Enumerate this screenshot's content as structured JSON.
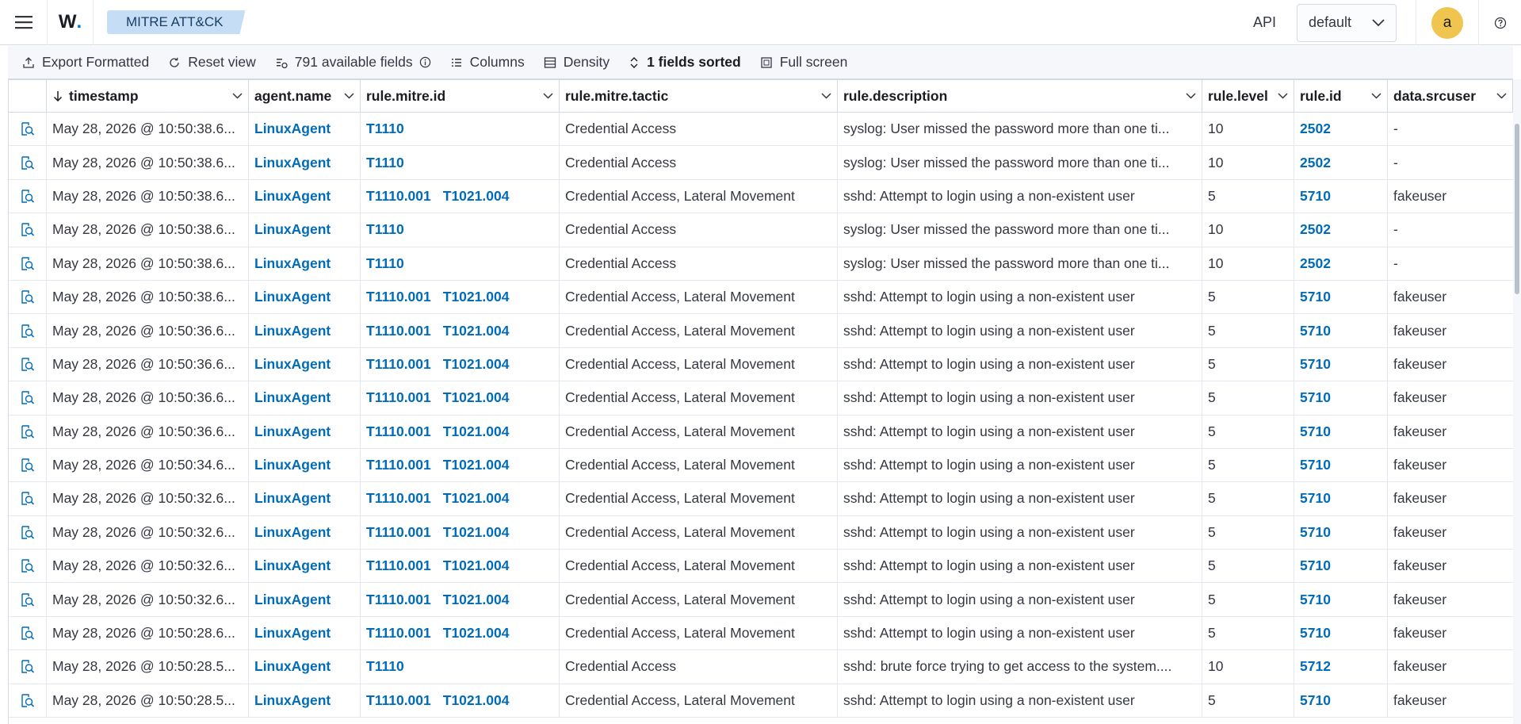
{
  "header": {
    "logo": "W",
    "logo_dot": ".",
    "breadcrumb": "MITRE ATT&CK",
    "api_label": "API",
    "tenant": "default",
    "avatar_initial": "a"
  },
  "toolbar": {
    "export": "Export Formatted",
    "reset": "Reset view",
    "fields": "791 available fields",
    "columns": "Columns",
    "density": "Density",
    "sorted": "1 fields sorted",
    "fullscreen": "Full screen"
  },
  "table": {
    "columns": [
      "timestamp",
      "agent.name",
      "rule.mitre.id",
      "rule.mitre.tactic",
      "rule.description",
      "rule.level",
      "rule.id",
      "data.srcuser"
    ],
    "rows": [
      {
        "timestamp": "May 28, 2026 @ 10:50:38.6...",
        "agent": "LinuxAgent",
        "mitre_ids": [
          "T1110"
        ],
        "tactic": "Credential Access",
        "description": "syslog: User missed the password more than one ti...",
        "level": "10",
        "rule_id": "2502",
        "srcuser": "-"
      },
      {
        "timestamp": "May 28, 2026 @ 10:50:38.6...",
        "agent": "LinuxAgent",
        "mitre_ids": [
          "T1110"
        ],
        "tactic": "Credential Access",
        "description": "syslog: User missed the password more than one ti...",
        "level": "10",
        "rule_id": "2502",
        "srcuser": "-"
      },
      {
        "timestamp": "May 28, 2026 @ 10:50:38.6...",
        "agent": "LinuxAgent",
        "mitre_ids": [
          "T1110.001",
          "T1021.004"
        ],
        "tactic": "Credential Access, Lateral Movement",
        "description": "sshd: Attempt to login using a non-existent user",
        "level": "5",
        "rule_id": "5710",
        "srcuser": "fakeuser"
      },
      {
        "timestamp": "May 28, 2026 @ 10:50:38.6...",
        "agent": "LinuxAgent",
        "mitre_ids": [
          "T1110"
        ],
        "tactic": "Credential Access",
        "description": "syslog: User missed the password more than one ti...",
        "level": "10",
        "rule_id": "2502",
        "srcuser": "-"
      },
      {
        "timestamp": "May 28, 2026 @ 10:50:38.6...",
        "agent": "LinuxAgent",
        "mitre_ids": [
          "T1110"
        ],
        "tactic": "Credential Access",
        "description": "syslog: User missed the password more than one ti...",
        "level": "10",
        "rule_id": "2502",
        "srcuser": "-"
      },
      {
        "timestamp": "May 28, 2026 @ 10:50:38.6...",
        "agent": "LinuxAgent",
        "mitre_ids": [
          "T1110.001",
          "T1021.004"
        ],
        "tactic": "Credential Access, Lateral Movement",
        "description": "sshd: Attempt to login using a non-existent user",
        "level": "5",
        "rule_id": "5710",
        "srcuser": "fakeuser"
      },
      {
        "timestamp": "May 28, 2026 @ 10:50:36.6...",
        "agent": "LinuxAgent",
        "mitre_ids": [
          "T1110.001",
          "T1021.004"
        ],
        "tactic": "Credential Access, Lateral Movement",
        "description": "sshd: Attempt to login using a non-existent user",
        "level": "5",
        "rule_id": "5710",
        "srcuser": "fakeuser"
      },
      {
        "timestamp": "May 28, 2026 @ 10:50:36.6...",
        "agent": "LinuxAgent",
        "mitre_ids": [
          "T1110.001",
          "T1021.004"
        ],
        "tactic": "Credential Access, Lateral Movement",
        "description": "sshd: Attempt to login using a non-existent user",
        "level": "5",
        "rule_id": "5710",
        "srcuser": "fakeuser"
      },
      {
        "timestamp": "May 28, 2026 @ 10:50:36.6...",
        "agent": "LinuxAgent",
        "mitre_ids": [
          "T1110.001",
          "T1021.004"
        ],
        "tactic": "Credential Access, Lateral Movement",
        "description": "sshd: Attempt to login using a non-existent user",
        "level": "5",
        "rule_id": "5710",
        "srcuser": "fakeuser"
      },
      {
        "timestamp": "May 28, 2026 @ 10:50:36.6...",
        "agent": "LinuxAgent",
        "mitre_ids": [
          "T1110.001",
          "T1021.004"
        ],
        "tactic": "Credential Access, Lateral Movement",
        "description": "sshd: Attempt to login using a non-existent user",
        "level": "5",
        "rule_id": "5710",
        "srcuser": "fakeuser"
      },
      {
        "timestamp": "May 28, 2026 @ 10:50:34.6...",
        "agent": "LinuxAgent",
        "mitre_ids": [
          "T1110.001",
          "T1021.004"
        ],
        "tactic": "Credential Access, Lateral Movement",
        "description": "sshd: Attempt to login using a non-existent user",
        "level": "5",
        "rule_id": "5710",
        "srcuser": "fakeuser"
      },
      {
        "timestamp": "May 28, 2026 @ 10:50:32.6...",
        "agent": "LinuxAgent",
        "mitre_ids": [
          "T1110.001",
          "T1021.004"
        ],
        "tactic": "Credential Access, Lateral Movement",
        "description": "sshd: Attempt to login using a non-existent user",
        "level": "5",
        "rule_id": "5710",
        "srcuser": "fakeuser"
      },
      {
        "timestamp": "May 28, 2026 @ 10:50:32.6...",
        "agent": "LinuxAgent",
        "mitre_ids": [
          "T1110.001",
          "T1021.004"
        ],
        "tactic": "Credential Access, Lateral Movement",
        "description": "sshd: Attempt to login using a non-existent user",
        "level": "5",
        "rule_id": "5710",
        "srcuser": "fakeuser"
      },
      {
        "timestamp": "May 28, 2026 @ 10:50:32.6...",
        "agent": "LinuxAgent",
        "mitre_ids": [
          "T1110.001",
          "T1021.004"
        ],
        "tactic": "Credential Access, Lateral Movement",
        "description": "sshd: Attempt to login using a non-existent user",
        "level": "5",
        "rule_id": "5710",
        "srcuser": "fakeuser"
      },
      {
        "timestamp": "May 28, 2026 @ 10:50:32.6...",
        "agent": "LinuxAgent",
        "mitre_ids": [
          "T1110.001",
          "T1021.004"
        ],
        "tactic": "Credential Access, Lateral Movement",
        "description": "sshd: Attempt to login using a non-existent user",
        "level": "5",
        "rule_id": "5710",
        "srcuser": "fakeuser"
      },
      {
        "timestamp": "May 28, 2026 @ 10:50:28.6...",
        "agent": "LinuxAgent",
        "mitre_ids": [
          "T1110.001",
          "T1021.004"
        ],
        "tactic": "Credential Access, Lateral Movement",
        "description": "sshd: Attempt to login using a non-existent user",
        "level": "5",
        "rule_id": "5710",
        "srcuser": "fakeuser"
      },
      {
        "timestamp": "May 28, 2026 @ 10:50:28.5...",
        "agent": "LinuxAgent",
        "mitre_ids": [
          "T1110"
        ],
        "tactic": "Credential Access",
        "description": "sshd: brute force trying to get access to the system....",
        "level": "10",
        "rule_id": "5712",
        "srcuser": "fakeuser"
      },
      {
        "timestamp": "May 28, 2026 @ 10:50:28.5...",
        "agent": "LinuxAgent",
        "mitre_ids": [
          "T1110.001",
          "T1021.004"
        ],
        "tactic": "Credential Access, Lateral Movement",
        "description": "sshd: Attempt to login using a non-existent user",
        "level": "5",
        "rule_id": "5710",
        "srcuser": "fakeuser"
      }
    ]
  }
}
